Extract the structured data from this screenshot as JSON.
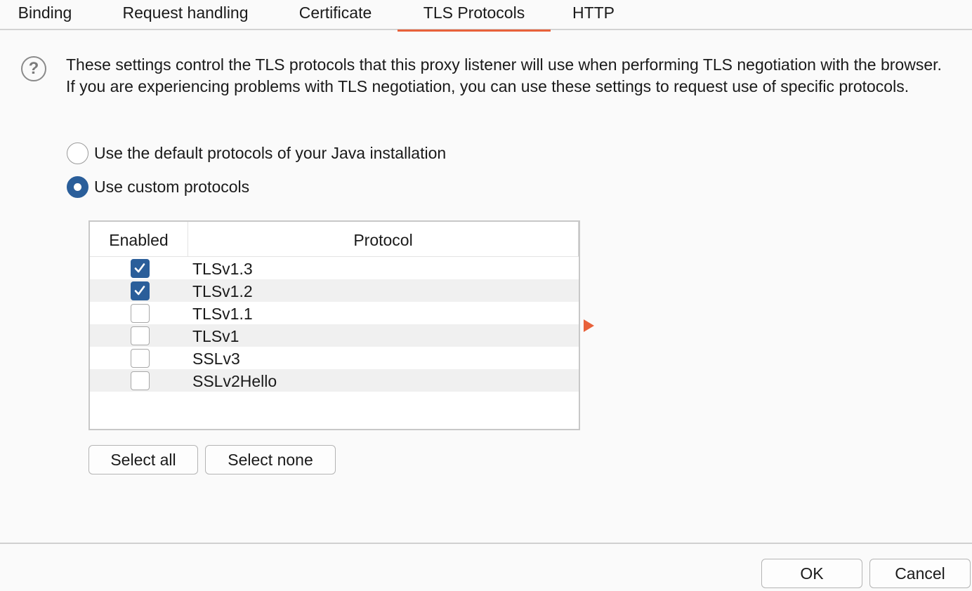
{
  "tabs": [
    {
      "label": "Binding",
      "active": false
    },
    {
      "label": "Request handling",
      "active": false
    },
    {
      "label": "Certificate",
      "active": false
    },
    {
      "label": "TLS Protocols",
      "active": true
    },
    {
      "label": "HTTP",
      "active": false
    }
  ],
  "help": {
    "icon": "question-circle-icon",
    "symbol": "?"
  },
  "description": "These settings control the TLS protocols that this proxy listener will use when performing TLS negotiation with the browser. If you are experiencing problems with TLS negotiation, you can use these settings to request use of specific protocols.",
  "options": {
    "default_label": "Use the default protocols of your Java installation",
    "default_selected": false,
    "custom_label": "Use custom protocols",
    "custom_selected": true
  },
  "table": {
    "headers": {
      "enabled": "Enabled",
      "protocol": "Protocol"
    },
    "rows": [
      {
        "enabled": true,
        "protocol": "TLSv1.3"
      },
      {
        "enabled": true,
        "protocol": "TLSv1.2"
      },
      {
        "enabled": false,
        "protocol": "TLSv1.1"
      },
      {
        "enabled": false,
        "protocol": "TLSv1"
      },
      {
        "enabled": false,
        "protocol": "SSLv3"
      },
      {
        "enabled": false,
        "protocol": "SSLv2Hello"
      }
    ]
  },
  "buttons": {
    "select_all": "Select all",
    "select_none": "Select none",
    "ok": "OK",
    "cancel": "Cancel"
  },
  "colors": {
    "accent": "#e8613a",
    "checked": "#2a5e9a"
  }
}
